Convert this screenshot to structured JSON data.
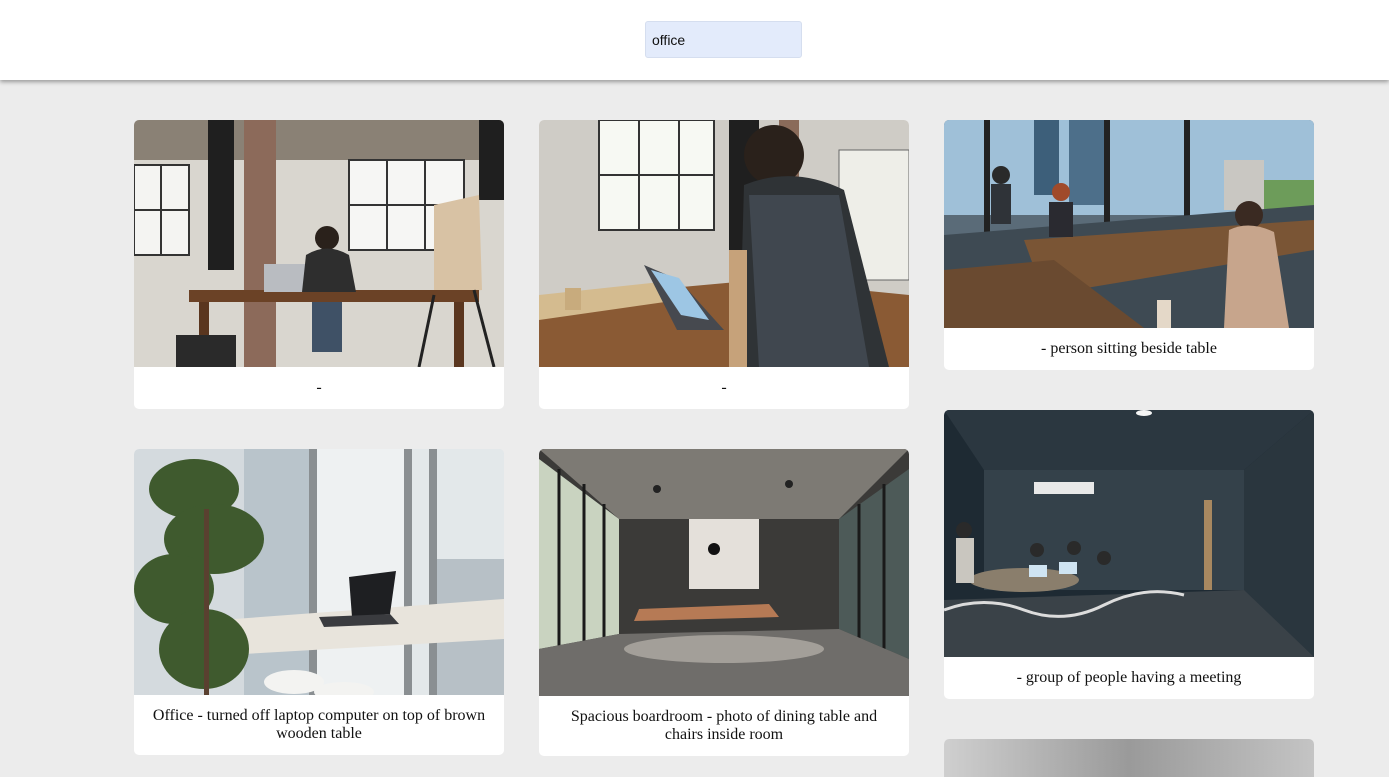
{
  "search": {
    "value": "office"
  },
  "cards": [
    {
      "caption": "-",
      "image": "woman-at-laptop-loft-photo"
    },
    {
      "caption": "-",
      "image": "man-with-laptop-and-tube-photo"
    },
    {
      "caption": "- person sitting beside table",
      "image": "highrise-office-workers-photo"
    },
    {
      "caption": "Office - turned off laptop computer on top of brown wooden table",
      "image": "laptop-window-plant-photo"
    },
    {
      "caption": "Spacious boardroom - photo of dining table and chairs inside room",
      "image": "boardroom-photo"
    },
    {
      "caption": "- group of people having a meeting",
      "image": "dark-meeting-room-photo"
    },
    {
      "caption": "",
      "image": "grey-photo"
    }
  ]
}
